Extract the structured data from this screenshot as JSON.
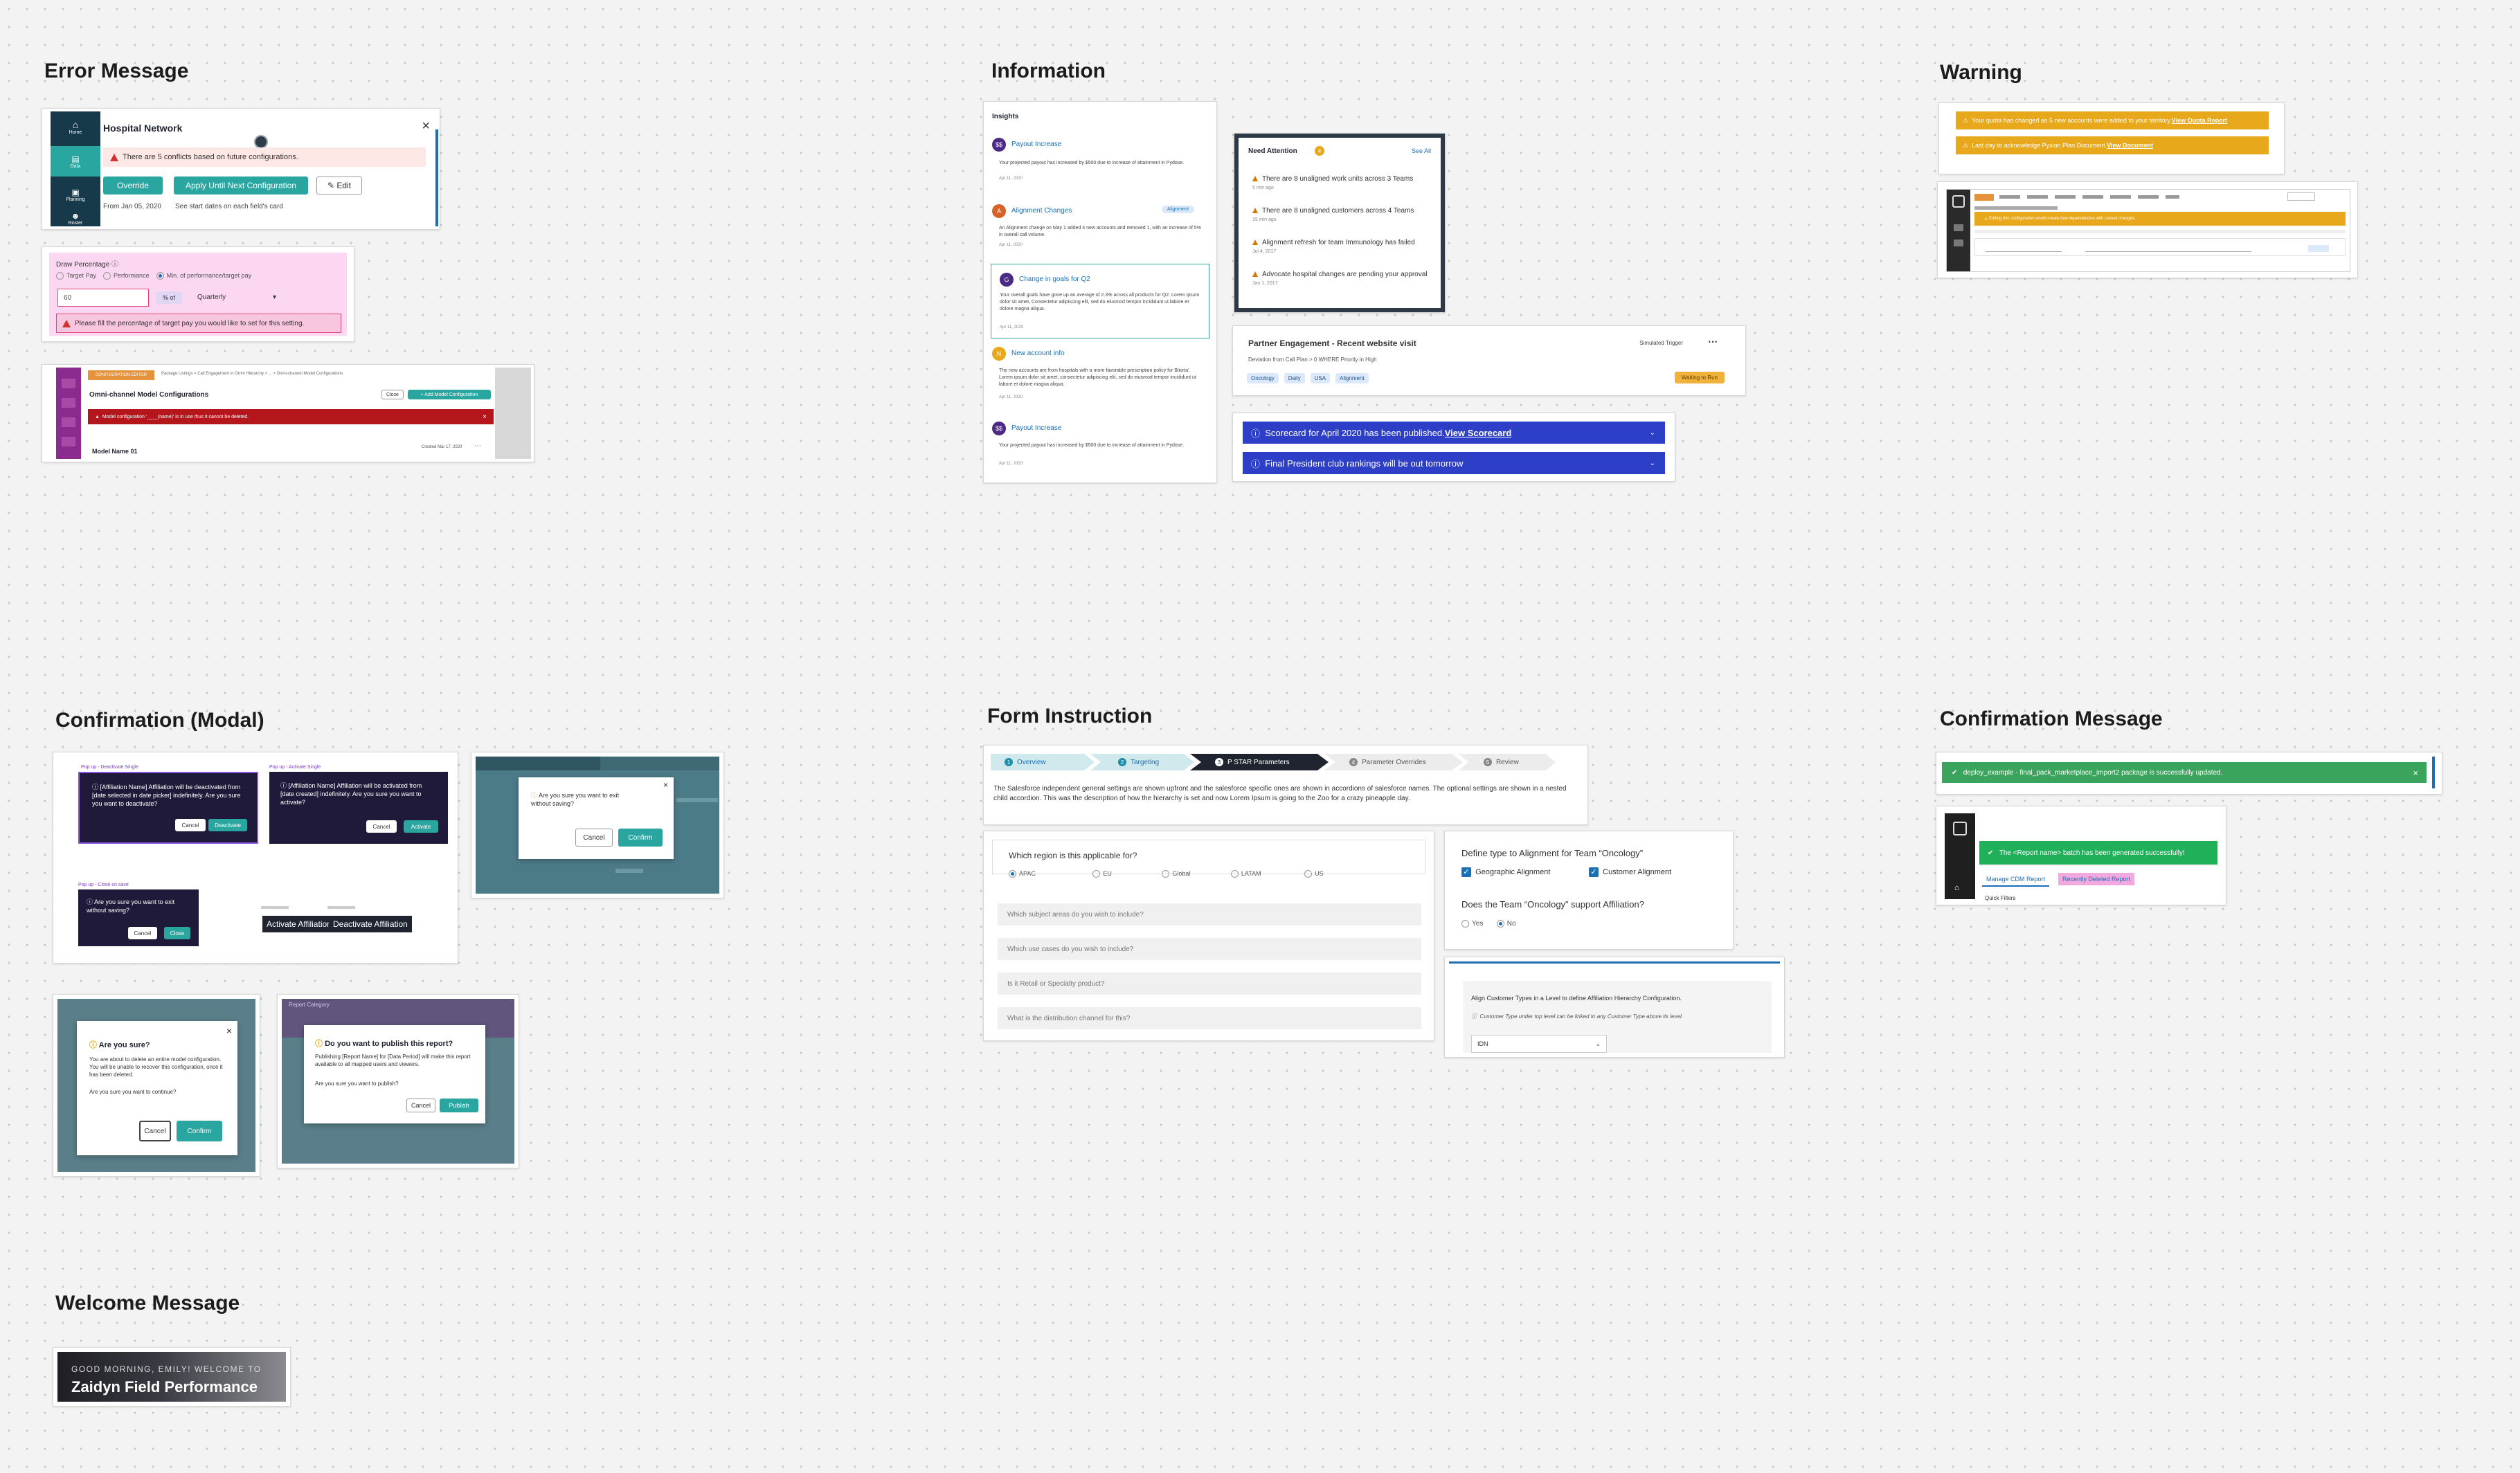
{
  "sections": {
    "error": "Error Message",
    "information": "Information",
    "warning": "Warning",
    "confirmation_modal": "Confirmation (Modal)",
    "form_instruction": "Form Instruction",
    "confirmation_message": "Confirmation Message",
    "welcome": "Welcome Message"
  },
  "error": {
    "hospital": {
      "side_items": [
        "Home",
        "Data",
        "Planning",
        "Roster"
      ],
      "title": "Hospital Network",
      "alert": "There are 5 conflicts based on future configurations.",
      "override": "Override",
      "apply": "Apply Until Next Configuration",
      "edit": "Edit",
      "from": "From Jan 05, 2020",
      "see": "See start dates on each field's card"
    },
    "draw": {
      "label": "Draw Percentage",
      "options": [
        "Target Pay",
        "Performance",
        "Min. of performance/target pay"
      ],
      "value": "60",
      "of": "% of",
      "period": "Quarterly",
      "error": "Please fill the percentage of target pay you would like to set for this setting."
    },
    "omni": {
      "badge": "CONFIGURATION EDITOR",
      "crumbs": "Package Listings  >  Call Engagement in Omni Hierarchy  >  ...  >  Omni-channel Model Configurations",
      "title": "Omni-channel Model Configurations",
      "close": "Close",
      "add": "+ Add Model Configuration",
      "alert": "Model configuration '____(name)' is in use thus it cannot be deleted.",
      "model": "Model Name 01",
      "created": "Created Mar 17, 2020"
    }
  },
  "info": {
    "insights": {
      "heading": "Insights",
      "items": [
        {
          "title": "Payout Increase",
          "tag": "",
          "body": "Your projected payout has increased by $500 due to increase of attainment in Pydose.",
          "date": "Apr 11, 2020",
          "color": "#4b2a86",
          "icon": "$$"
        },
        {
          "title": "Alignment Changes",
          "tag": "Alignment",
          "body": "An Alignment change on May 1 added 4 new accounts and removed 1, with an increase of 5% in overall call volume.",
          "date": "Apr 11, 2020",
          "color": "#d9622b",
          "icon": "A"
        },
        {
          "title": "Change in goals for Q2",
          "tag": "",
          "body": "Your overall goals have gone up an average of 2.3% across all products for Q2. Lorem ipsum dolor sit amet, Consectetur adipiscing elit, sed do eiusmod tempor incididunt ut labore et dolore magna aliqua.",
          "date": "Apr 11, 2020",
          "color": "#4b2a86",
          "icon": "G"
        },
        {
          "title": "New account info",
          "tag": "",
          "body": "The new accounts are from hospitals with a more favorable prescription policy for Bliorta'. Lorem ipsum dolor sit amet, consectetur adipiscing elit, sed do eiusmod tempor incididunt ut labore et dolore magna aliqua.",
          "date": "Apr 11, 2020",
          "color": "#e8a81c",
          "icon": "N"
        },
        {
          "title": "Payout Increase",
          "tag": "",
          "body": "Your projected payout has increased by $500 due to increase of attainment in Pydose.",
          "date": "Apr 11, 2020",
          "color": "#4b2a86",
          "icon": "$$"
        }
      ]
    },
    "need": {
      "title": "Need Attention",
      "count": "4",
      "see_all": "See All",
      "rows": [
        {
          "text": "There are 8 unaligned work units across 3 Teams",
          "sub": "5 min ago"
        },
        {
          "text": "There are 8 unaligned customers across 4 Teams",
          "sub": "15 min ago"
        },
        {
          "text": "Alignment refresh for team Immunology has failed",
          "sub": "Jul 4, 2017"
        },
        {
          "text": "Advocate hospital changes are pending your approval",
          "sub": "Jan 1, 2017"
        }
      ]
    },
    "partner": {
      "title": "Partner Engagement - Recent website visit",
      "trigger": "Simulated Trigger",
      "sub": "Deviation from Call Plan > 0 WHERE Priority in High",
      "tags": [
        "Oncology",
        "Daily",
        "USA",
        "Alignment"
      ],
      "status": "Waiting to Run"
    },
    "banners": [
      {
        "text": "Scorecard for April 2020 has been published. ",
        "link": "View Scorecard"
      },
      {
        "text": "Final President club rankings will be out tomorrow",
        "link": ""
      }
    ]
  },
  "warning": {
    "banners": [
      {
        "text": "Your quota has changed as 5 new accounts were added to your territory. ",
        "link": "View Quota Report"
      },
      {
        "text": "Last day to acknowledge Pyxion Plan Document. ",
        "link": "View Document"
      }
    ],
    "app": {
      "banner": "Editing this configuration would create new dependencies with current changes."
    }
  },
  "modal": {
    "panels": [
      {
        "label": "Pop up - Deactivate Single",
        "text": "[Affiliation Name] Affiliation will be deactivated from [date selected in date picker] indefinitely. Are you sure you want to deactivate?",
        "cancel": "Cancel",
        "ok": "Deactivate"
      },
      {
        "label": "Pop up - Activate Single",
        "text": "[Affiliation Name] Affiliation will be activated from [date created] indefinitely. Are you sure you want to activate?",
        "cancel": "Cancel",
        "ok": "Activate"
      },
      {
        "label": "Pop up - Close on save",
        "text": "Are you sure you want to exit without saving?",
        "cancel": "Cancel",
        "ok": "Close"
      }
    ],
    "tooltips": [
      "Activate Affiliation",
      "Deactivate Affiliation"
    ],
    "exit": {
      "text": "Are you sure you want to exit without saving?",
      "cancel": "Cancel",
      "ok": "Confirm"
    },
    "sure": {
      "title": "Are you sure?",
      "body": "You are about to delete an entire model configuration. You will be unable to recover this configuration, once it has been deleted.",
      "q": "Are you sure you want to continue?",
      "cancel": "Cancel",
      "ok": "Confirm"
    },
    "publish": {
      "title": "Do you want to publish this report?",
      "body": "Publishing [Report Name] for [Data Period] will make this report available to all mapped users and viewers.",
      "q": "Are you sure you want to publish?",
      "cancel": "Cancel",
      "ok": "Publish",
      "bg": "Report Category"
    }
  },
  "form": {
    "steps": [
      "Overview",
      "Targeting",
      "P STAR Parameters",
      "Parameter Overrides",
      "Review"
    ],
    "step_nums": [
      "1",
      "2",
      "3",
      "4",
      "5"
    ],
    "desc": "The Salesforce independent general settings are shown upfront and the salesforce specific ones are shown in accordions of salesforce names. The optional settings are shown in a nested child accordion. This was the description of how the hierarchy is set and now Lorem Ipsum is going to the Zoo for a crazy pineapple day.",
    "region_q": "Which region is this applicable for?",
    "regions": [
      "APAC",
      "EU",
      "Global",
      "LATAM",
      "US"
    ],
    "fields": [
      "Which subject areas do you wish to include?",
      "Which use cases do you wish to include?",
      "Is it Retail or Specialty product?",
      "What is the distribution channel for this?"
    ],
    "define_q": "Define type to Alignment for Team “Oncology”",
    "checks": [
      "Geographic Alignment",
      "Customer Alignment"
    ],
    "support_q": "Does the Team “Oncology” support Affiliation?",
    "yesno": [
      "Yes",
      "No"
    ],
    "align_title": "Align Customer Types in a Level to define Affiliation Hierarchy Configuration.",
    "align_note": "Customer Type under top level can be linked to any Customer Type above its level.",
    "align_val": "IDN"
  },
  "confirm": {
    "toast": "deploy_example - final_pack_marketplace_import2 package is successfully updated.",
    "batch": "The <Report name> batch has been generated successfully!",
    "tab1": "Manage CDM Report",
    "tab2": "Recently Deleted Report",
    "quick": "Quick Filters"
  },
  "welcome": {
    "greet": "GOOD MORNING, EMILY! WELCOME TO",
    "name": "Zaidyn Field Performance"
  }
}
